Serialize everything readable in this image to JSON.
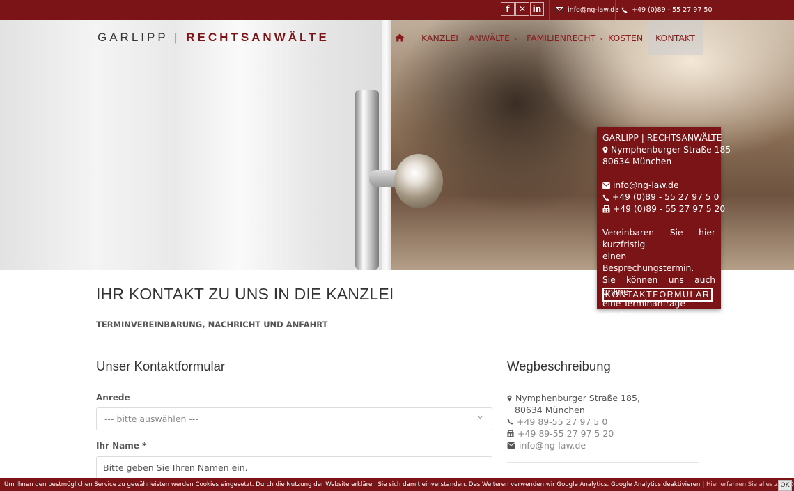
{
  "topbar": {
    "social": [
      {
        "name": "facebook",
        "glyph": "f"
      },
      {
        "name": "xing",
        "glyph": "✕"
      },
      {
        "name": "linkedin",
        "glyph": "in"
      }
    ],
    "email": "info@ng-law.de",
    "phone": "+49 (0)89 - 55 27 97 50"
  },
  "logo": {
    "part1": "GARLIPP |",
    "part2": "RECHTSANWÄLTE"
  },
  "nav": {
    "home_icon": "home-icon",
    "items": [
      "KANZLEI",
      "ANWÄLTE",
      "FAMILIENRECHT",
      "KOSTEN",
      "KONTAKT"
    ],
    "active": "KONTAKT"
  },
  "contact_box": {
    "title": "GARLIPP | RECHTSANWÄLTE",
    "street": "Nymphenburger Straße 185",
    "city": "80634 München",
    "email": "info@ng-law.de",
    "phone": "+49 (0)89 - 55 27 97 5 0",
    "fax": "+49 (0)89 - 55 27 97 5 20",
    "text_lines": [
      "Vereinbaren Sie hier kurzfristig",
      "einen Besprechungstermin.",
      "Sie können uns auch online",
      "eine Terminanfrage senden."
    ],
    "button": "KONTAKTFORMULAR"
  },
  "page": {
    "title": "IHR KONTAKT ZU UNS IN DIE KANZLEI",
    "subtitle": "TERMINVEREINBARUNG, NACHRICHT UND ANFAHRT"
  },
  "form": {
    "heading": "Unser Kontaktformular",
    "salutation_label": "Anrede",
    "salutation_value": "--- bitte auswählen ---",
    "name_label": "Ihr Name *",
    "name_placeholder": "Bitte geben Sie Ihren Namen ein."
  },
  "directions": {
    "heading": "Wegbeschreibung",
    "street": "Nymphenburger Straße 185,",
    "city": "80634 München",
    "phone": "+49 89-55 27 97 5 0",
    "fax": "+49 89-55 27 97 5 20",
    "email": "info@ng-law.de"
  },
  "cookie": {
    "text": "Um Ihnen den bestmöglichen Service zu gewährleisten werden Cookies eingesetzt. Durch die Nutzung der Website erklären Sie sich damit einverstanden. Des Weiteren verwenden wir Google Analytics. Google Analytics deaktivieren",
    "link": "| Hier erfahren Sie alles zum Datenschutz",
    "ok": "OK"
  },
  "colors": {
    "brand": "#7b1416",
    "text": "#555555",
    "heading": "#333333"
  }
}
